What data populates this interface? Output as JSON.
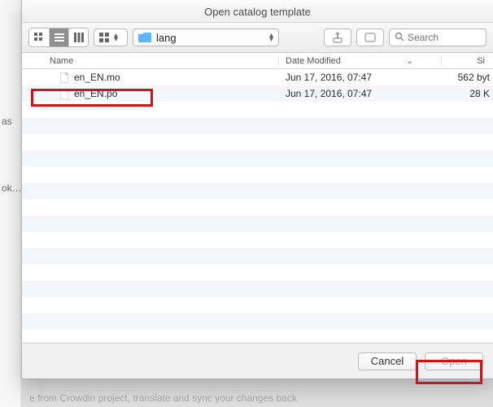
{
  "dialog": {
    "title": "Open catalog template"
  },
  "toolbar": {
    "folder_label": "lang",
    "search_placeholder": "Search"
  },
  "columns": {
    "name": "Name",
    "date": "Date Modified",
    "size": "Si"
  },
  "files": [
    {
      "name": "en_EN.mo",
      "date": "Jun 17, 2016, 07:47",
      "size": "562 byt"
    },
    {
      "name": "en_EN.po",
      "date": "Jun 17, 2016, 07:47",
      "size": "28 K"
    }
  ],
  "footer": {
    "cancel": "Cancel",
    "open": "Open"
  },
  "sidebar_fragments": {
    "a": "as",
    "b": "ok…"
  },
  "background": {
    "line1": "",
    "line2": "e from Crowdin project, translate and sync your changes back"
  }
}
